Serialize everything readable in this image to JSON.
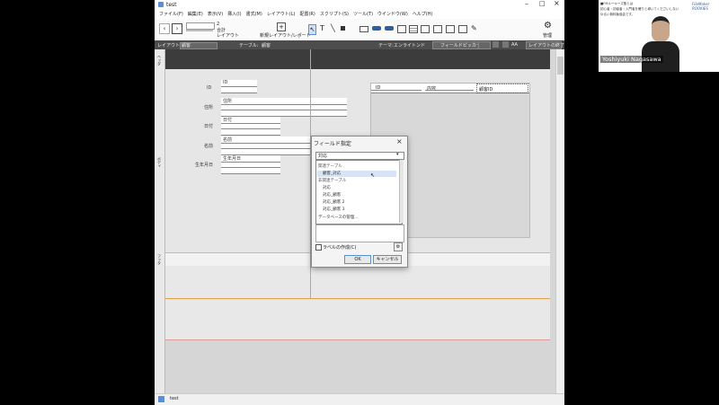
{
  "window": {
    "title": "test"
  },
  "menu": [
    "ファイル(F)",
    "編集(E)",
    "表示(V)",
    "挿入(I)",
    "書式(M)",
    "レイアウト(L)",
    "配置(R)",
    "スクリプト(S)",
    "ツール(T)",
    "ウインドウ(W)",
    "ヘルプ(H)"
  ],
  "toolbar": {
    "page_value": "2",
    "total_label": "合計",
    "layout_label": "レイアウト",
    "new_layout_label": "新規レイアウト/レポート",
    "manage_label": "管理"
  },
  "layout_bar": {
    "layout_label": "レイアウト:",
    "layout_value": "顧客",
    "table_label": "テーブル:",
    "table_value": "顧客",
    "theme_label": "テーマ:",
    "theme_value": "エンライトンド",
    "field_picker": "フィールドピッカー",
    "aa": "AA",
    "exit_layout": "レイアウトの終了"
  },
  "parts": {
    "header": "ヘッダ",
    "body": "ボディ",
    "footer": "フッタ"
  },
  "layout_fields": [
    {
      "label": "ID",
      "name": "ID"
    },
    {
      "label": "住所",
      "name": "住所"
    },
    {
      "label": "日付",
      "name": "日付"
    },
    {
      "label": "名前",
      "name": "名前"
    },
    {
      "label": "生年月日",
      "name": "生年月日"
    }
  ],
  "portal": {
    "columns": [
      "ID",
      "内容",
      "顧客ID"
    ]
  },
  "dialog": {
    "title": "フィールド指定",
    "close": "×",
    "selected": "対応",
    "list": [
      "関連テーブル",
      "顧客_対応",
      "非関連テーブル",
      "対応",
      "対応_顧客",
      "対応_顧客 2",
      "対応_顧客 3",
      "データベースの管理..."
    ],
    "checkbox_label": "ラベルの作成(C)",
    "ok": "OK",
    "cancel": "キャンセル"
  },
  "webcam": {
    "name": "Yoshiyuki Nagasawa",
    "caption_line1": "■FMルーキーズ塾とは",
    "caption_line2": "初心者・初級者・入門者を確りと導いてくださいしない",
    "caption_line3": "ゆるい無料勉強会です。",
    "logo": "FileMaker ROOKIES"
  },
  "taskbar": {
    "item": "test"
  },
  "colors": {
    "accent": "#e0a050",
    "header_part": "#3c3c3c",
    "select_border": "#5b8fd6"
  }
}
